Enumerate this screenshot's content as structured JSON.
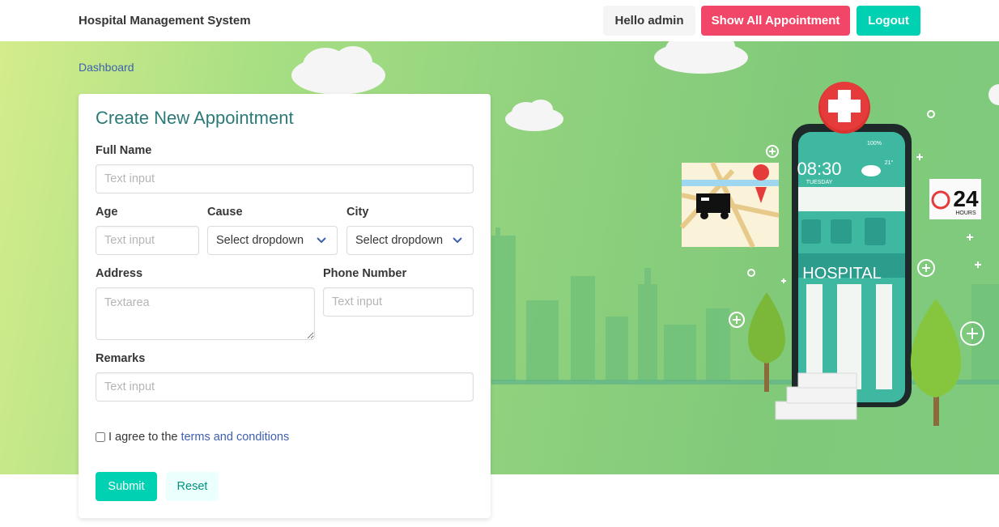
{
  "navbar": {
    "brand": "Hospital Management System",
    "greeting": "Hello admin",
    "show_all": "Show All Appointment",
    "logout": "Logout"
  },
  "breadcrumb": {
    "label": "Dashboard"
  },
  "form": {
    "title": "Create New Appointment",
    "full_name": {
      "label": "Full Name",
      "placeholder": "Text input"
    },
    "age": {
      "label": "Age",
      "placeholder": "Text input"
    },
    "cause": {
      "label": "Cause",
      "value": "Select dropdown"
    },
    "city": {
      "label": "City",
      "value": "Select dropdown"
    },
    "address": {
      "label": "Address",
      "placeholder": "Textarea"
    },
    "phone": {
      "label": "Phone Number",
      "placeholder": "Text input"
    },
    "remarks": {
      "label": "Remarks",
      "placeholder": "Text input"
    },
    "agree_text": "I agree to the",
    "terms_link": "terms and conditions",
    "submit": "Submit",
    "reset": "Reset"
  },
  "illustration": {
    "clock": "08:30",
    "day": "TUESDAY",
    "sign": "HOSPITAL",
    "badge_number": "24",
    "badge_text": "HOURS",
    "battery": "100%",
    "temp": "21°"
  },
  "colors": {
    "primary": "#00d1b2",
    "danger": "#f14668",
    "title": "#2b7a78",
    "link": "#3e5fb0"
  }
}
